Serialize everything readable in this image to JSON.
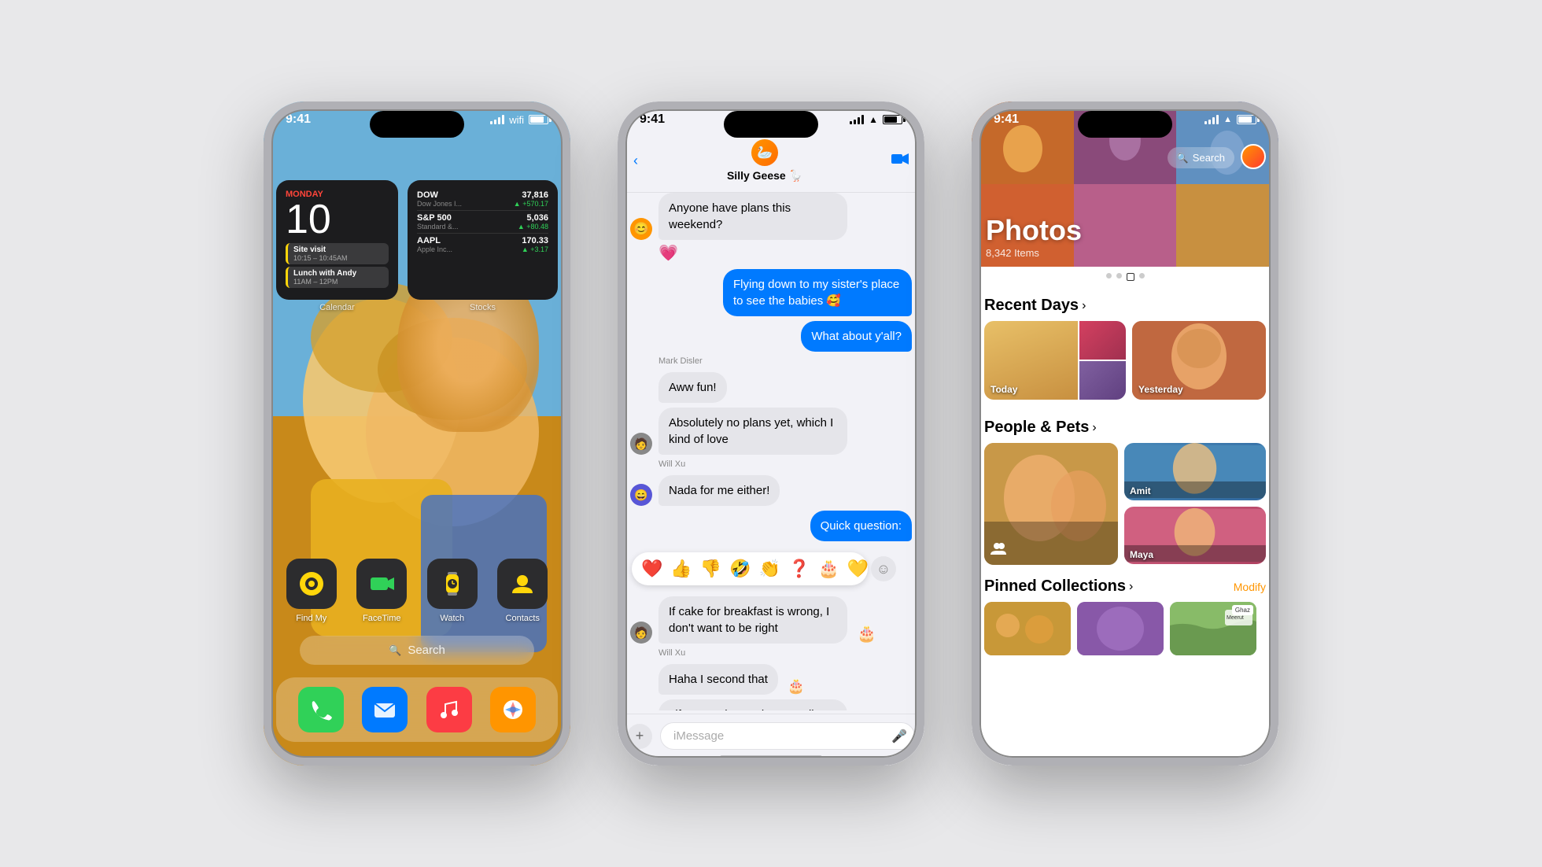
{
  "background_color": "#e8e8ea",
  "phones": {
    "phone1": {
      "status_time": "9:41",
      "widgets": {
        "calendar": {
          "day": "MONDAY",
          "number": "10",
          "events": [
            {
              "title": "Site visit",
              "time": "10:15 – 10:45AM"
            },
            {
              "title": "Lunch with Andy",
              "time": "11AM – 12PM"
            }
          ],
          "label": "Calendar"
        },
        "stocks": {
          "label": "Stocks",
          "items": [
            {
              "name": "DOW",
              "desc": "Dow Jones I...",
              "price": "37,816",
              "change": "▲ +570.17"
            },
            {
              "name": "S&P 500",
              "desc": "Standard &...",
              "price": "5,036",
              "change": "▲ +80.48"
            },
            {
              "name": "AAPL",
              "desc": "Apple Inc...",
              "price": "170.33",
              "change": "▲ +3.17"
            }
          ]
        }
      },
      "apps": [
        {
          "label": "Find My",
          "icon": "🎯",
          "bg": "#2c2c2e"
        },
        {
          "label": "FaceTime",
          "icon": "📹",
          "bg": "#2c2c2e"
        },
        {
          "label": "Watch",
          "icon": "⌚",
          "bg": "#2c2c2e"
        },
        {
          "label": "Contacts",
          "icon": "👤",
          "bg": "#2c2c2e"
        }
      ],
      "dock": [
        {
          "icon": "📞",
          "bg": "#30d158",
          "label": "Phone"
        },
        {
          "icon": "✉️",
          "bg": "#007aff",
          "label": "Mail"
        },
        {
          "icon": "🎵",
          "bg": "#fc3c44",
          "label": "Music"
        },
        {
          "icon": "🧭",
          "bg": "#ff9500",
          "label": "Safari"
        }
      ],
      "search_label": "🔍 Search"
    },
    "phone2": {
      "status_time": "9:41",
      "group_name": "Silly Geese 🪿",
      "messages": [
        {
          "type": "received",
          "text": "Anyone have plans this weekend?",
          "avatar": "😊"
        },
        {
          "type": "heart",
          "emoji": "💗"
        },
        {
          "type": "sent",
          "text": "Flying down to my sister's place to see the babies 🥰"
        },
        {
          "type": "sent",
          "text": "What about y'all?"
        },
        {
          "type": "sender_name",
          "name": "Mark Disler"
        },
        {
          "type": "received",
          "text": "Aww fun!",
          "avatar": ""
        },
        {
          "type": "received",
          "text": "Absolutely no plans yet, which I kind of love",
          "avatar": "🧑"
        },
        {
          "type": "sender_name",
          "name": "Will Xu"
        },
        {
          "type": "received",
          "text": "Nada for me either!",
          "avatar": "😄"
        },
        {
          "type": "sent",
          "text": "Quick question:"
        },
        {
          "type": "reactions",
          "emojis": [
            "❤️",
            "👍",
            "👎",
            "🤣",
            "👏",
            "❓",
            "🎂",
            "💛"
          ]
        },
        {
          "type": "received_group",
          "text": "If cake for breakfast is wrong, I don't want to be right",
          "avatar": "🧑"
        },
        {
          "type": "sender_name",
          "name": "Will Xu"
        },
        {
          "type": "received",
          "text": "Haha I second that",
          "avatar": ""
        },
        {
          "type": "received_small",
          "text": "Life's too short to leave a slice behind",
          "avatar": "🧑"
        }
      ],
      "input_placeholder": "iMessage"
    },
    "phone3": {
      "status_time": "9:41",
      "title": "Photos",
      "subtitle": "8,342 Items",
      "search_label": "Search",
      "sections": {
        "recent_days": {
          "title": "Recent Days",
          "items": [
            "Today",
            "Yesterday"
          ]
        },
        "people_pets": {
          "title": "People & Pets",
          "people": [
            "Amit",
            "Maya"
          ]
        },
        "pinned": {
          "title": "Pinned Collections",
          "modify_label": "Modify"
        }
      }
    }
  }
}
